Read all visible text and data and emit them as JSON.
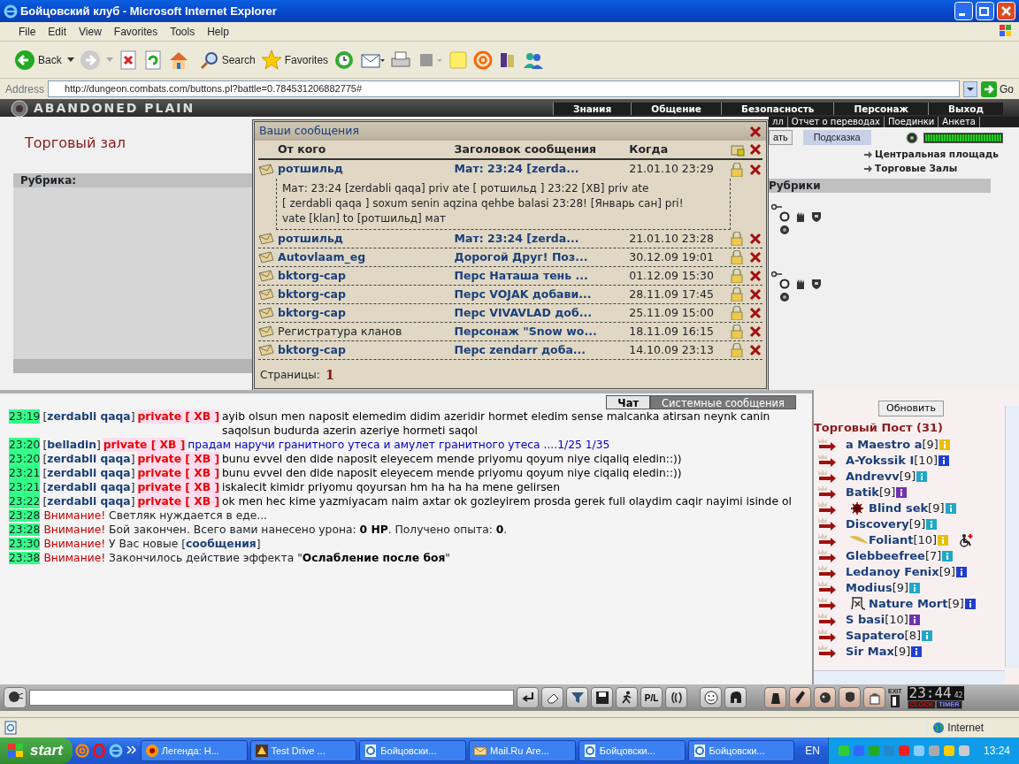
{
  "window": {
    "title": "Бойцовский клуб - Microsoft Internet Explorer"
  },
  "menu": [
    "File",
    "Edit",
    "View",
    "Favorites",
    "Tools",
    "Help"
  ],
  "toolbar": {
    "back": "Back",
    "search": "Search",
    "favorites": "Favorites"
  },
  "address": {
    "label": "Address",
    "url": "http://dungeon.combats.com/buttons.pl?battle=0.784531206882775#",
    "go": "Go"
  },
  "game": {
    "logo": "ABANDONED PLAIN",
    "nav": [
      "Знания",
      "Общение",
      "Безопасность",
      "Персонаж",
      "Выход"
    ],
    "subnav": [
      "лл",
      "Отчет о переводах",
      "Поединки",
      "Анкета"
    ],
    "room_title": "Торговый зал",
    "rubric_label": "Рубрика:",
    "partial_button": "ать",
    "hint_tab": "Подсказка",
    "hp_meter": {
      "level": 1
    },
    "links": [
      "Центральная площадь",
      "Торговые Залы"
    ],
    "rubrics_label": "Рубрики"
  },
  "messages_dialog": {
    "title": "Ваши сообщения",
    "columns": [
      "От кого",
      "Заголовок сообщения",
      "Когда"
    ],
    "rows": [
      {
        "from": "ротшильд",
        "kind": "user",
        "subject": "Мат: 23:24 [zerda...",
        "when": "21.01.10 23:29",
        "expanded": true,
        "body": [
          "Мат: 23:24 [zerdabli qaqa] priv ate [ ротшильд ] 23:22 [XB] priv ate",
          "[ zerdabli qaqa ] soxum senin aqzina qehbe balasi 23:28! [Январь сан] pri!",
          "vate [klan] to [ротшильд] мат"
        ]
      },
      {
        "from": "ротшильд",
        "kind": "user",
        "subject": "Мат: 23:24 [zerda...",
        "when": "21.01.10 23:28",
        "expanded": false
      },
      {
        "from": "Autovlaam_eg",
        "kind": "user",
        "subject": "Дорогой Друг! Поз...",
        "when": "30.12.09 19:01",
        "expanded": false
      },
      {
        "from": "bktorg-cap",
        "kind": "user",
        "subject": "Перс Наташа тень ...",
        "when": "01.12.09 15:30",
        "expanded": false
      },
      {
        "from": "bktorg-cap",
        "kind": "user",
        "subject": "Перс VOJAK добави...",
        "when": "28.11.09 17:45",
        "expanded": false
      },
      {
        "from": "bktorg-cap",
        "kind": "user",
        "subject": "Перс VIVAVLAD доб...",
        "when": "25.11.09 15:00",
        "expanded": false
      },
      {
        "from": "Регистратура кланов",
        "kind": "system",
        "subject": "Персонаж \"Snow wo...",
        "when": "18.11.09 16:15",
        "expanded": false
      },
      {
        "from": "bktorg-cap",
        "kind": "user",
        "subject": "Перс zendarr доба...",
        "when": "14.10.09 23:13",
        "expanded": false
      }
    ],
    "pages_label": "Страницы:",
    "page": "1"
  },
  "chat": {
    "tabs": [
      {
        "label": "Чат",
        "selected": true
      },
      {
        "label": "Системные сообщения",
        "selected": false
      }
    ],
    "lines": [
      {
        "kind": "private",
        "time": "23:19",
        "sender": "[**zerdabli qaqa**]",
        "tag": "private [ XB ]",
        "text": "ayib olsun men naposit elemedim didim azeridir hormet eledim sense malcanka atirsan neynk canin saqolsun budurda azerin azeriye hormeti saqol",
        "color": "#000000"
      },
      {
        "kind": "private",
        "time": "23:20",
        "sender": "[**belladin**]",
        "tag": "private [ XB ]",
        "text": "прадам наручи гранитного утеса и амулет гранитного утеса ....1/25 1/35",
        "color": "#0000cc"
      },
      {
        "kind": "private",
        "time": "23:20",
        "sender": "[**zerdabli qaqa**]",
        "tag": "private [ XB ]",
        "text": "bunu evvel den dide naposit eleyecem mende priyomu qoyum niye ciqaliq eledin::))",
        "color": "#000000"
      },
      {
        "kind": "private",
        "time": "23:21",
        "sender": "[**zerdabli qaqa**]",
        "tag": "private [ XB ]",
        "text": "bunu evvel den dide naposit eleyecem mende priyomu qoyum niye ciqaliq eledin::))",
        "color": "#000000"
      },
      {
        "kind": "private",
        "time": "23:21",
        "sender": "[**zerdabli qaqa**]",
        "tag": "private [ XB ]",
        "text": "iskalecit kimidr priyomu qoyursan hm ha ha ha mene gelirsen",
        "color": "#000000"
      },
      {
        "kind": "private",
        "time": "23:22",
        "sender": "[**zerdabli qaqa**]",
        "tag": "private [ XB ]",
        "text": "ok men hec kime yazmiyacam naim axtar ok gozleyirem prosda gerek full olaydim caqir nayimi isinde ol",
        "color": "#000000"
      },
      {
        "kind": "system",
        "time": "23:28",
        "label": "Внимание!",
        "text": "Светляк нуждается в еде..."
      },
      {
        "kind": "system",
        "time": "23:28",
        "label": "Внимание!",
        "text": "Бой закончен. Всего вами нанесено урона: **0 HP**. Получено опыта: **0**."
      },
      {
        "kind": "system",
        "time": "23:30",
        "label": "Внимание!",
        "text": "У Вас новые [**сообщения**]"
      },
      {
        "kind": "system",
        "time": "23:38",
        "label": "Внимание!",
        "text": "Закончилось действие эффекта \"**Ослабление после боя**\""
      }
    ]
  },
  "room_list": {
    "refresh": "Обновить",
    "title": "Торговый Пост (31)",
    "players": [
      {
        "name": "a Maestro a",
        "level": "[9]",
        "color": "#e8c000",
        "kind": "plain",
        "injured": false
      },
      {
        "name": "A-Yokssik I",
        "level": "[10]",
        "color": "#1f3fd0",
        "kind": "plain",
        "injured": false
      },
      {
        "name": "Andrevv",
        "level": "[9]",
        "color": "#20a8c8",
        "kind": "plain",
        "injured": false
      },
      {
        "name": "Batik",
        "level": "[9]",
        "color": "#7030b0",
        "kind": "plain",
        "injured": false
      },
      {
        "name": "Blind sek",
        "level": "[9]",
        "color": "#20a8c8",
        "kind": "star",
        "injured": false
      },
      {
        "name": "Discovery",
        "level": "[9]",
        "color": "#20a8c8",
        "kind": "plain",
        "injured": false
      },
      {
        "name": "Foliant",
        "level": "[10]",
        "color": "#e8c000",
        "kind": "wing",
        "injured": true
      },
      {
        "name": "Glebbeefree",
        "level": "[7]",
        "color": "#20a8c8",
        "kind": "plain",
        "injured": false
      },
      {
        "name": "Ledanoy Fenix",
        "level": "[9]",
        "color": "#1f3fd0",
        "kind": "plain",
        "injured": false
      },
      {
        "name": "Modius",
        "level": "[9]",
        "color": "#20a8c8",
        "kind": "plain",
        "injured": false
      },
      {
        "name": "Nature Mort",
        "level": "[9]",
        "color": "#1f3fd0",
        "kind": "glyph",
        "injured": false
      },
      {
        "name": "S basi",
        "level": "[10]",
        "color": "#7030b0",
        "kind": "plain",
        "injured": false
      },
      {
        "name": "Sapatero",
        "level": "[8]",
        "color": "#20a8c8",
        "kind": "plain",
        "injured": false
      },
      {
        "name": "Sir Max",
        "level": "[9]",
        "color": "#1f3fd0",
        "kind": "plain",
        "injured": false
      }
    ]
  },
  "bottom_bar": {
    "pl": "P/L",
    "exit": "EXIT",
    "clock": "23:44",
    "seconds": "42",
    "clock_label": "CLOCK",
    "timer_label": "TIMER"
  },
  "status_bar": {
    "zone": "Internet"
  },
  "taskbar": {
    "start": "start",
    "tasks": [
      "Легенда: Н...",
      "Test Drive ...",
      "Бойцовски...",
      "Mail.Ru Аге...",
      "Бойцовски...",
      "Бойцовски..."
    ],
    "lang": "EN",
    "time": "13:24"
  }
}
